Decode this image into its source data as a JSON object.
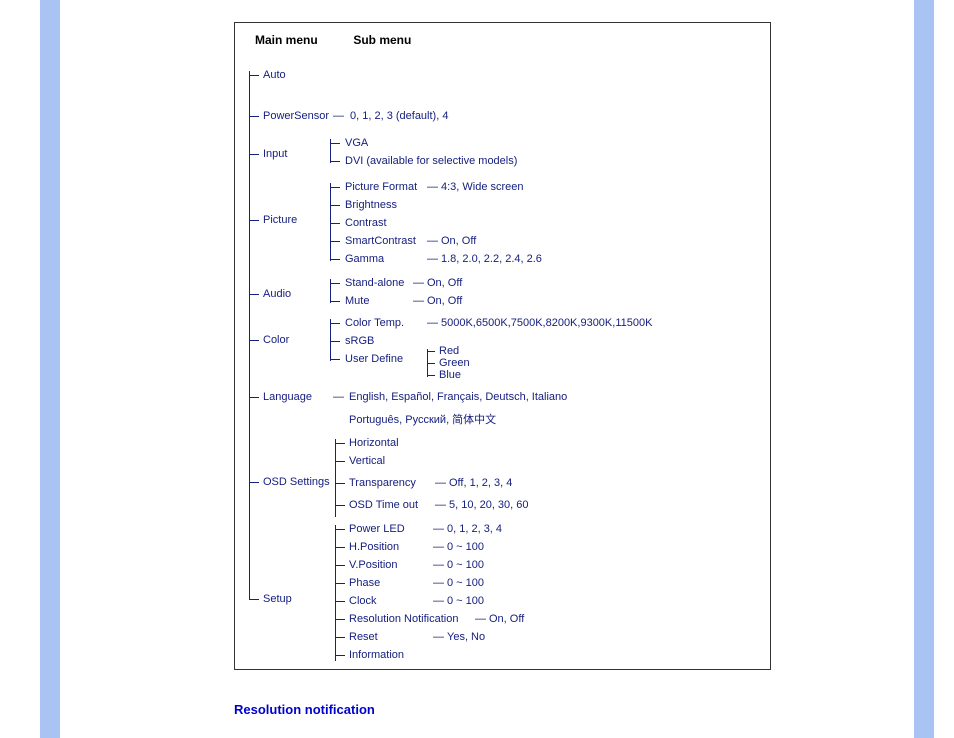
{
  "header": {
    "main": "Main menu",
    "sub": "Sub menu"
  },
  "main": {
    "auto": "Auto",
    "powersensor": "PowerSensor",
    "input": "Input",
    "picture": "Picture",
    "audio": "Audio",
    "color": "Color",
    "language": "Language",
    "osd": "OSD Settings",
    "setup": "Setup"
  },
  "powersensor": {
    "values": "0, 1, 2, 3 (default), 4"
  },
  "input": {
    "vga": "VGA",
    "dvi": "DVI (available for selective models)"
  },
  "picture": {
    "pf": "Picture Format",
    "pf_vals": "4:3, Wide screen",
    "brightness": "Brightness",
    "contrast": "Contrast",
    "sc": "SmartContrast",
    "sc_vals": "On, Off",
    "gamma": "Gamma",
    "gamma_vals": "1.8, 2.0, 2.2, 2.4, 2.6"
  },
  "audio": {
    "standalone": "Stand-alone",
    "standalone_vals": "On, Off",
    "mute": "Mute",
    "mute_vals": "On, Off"
  },
  "color": {
    "temp": "Color Temp.",
    "temp_vals": "5000K,6500K,7500K,8200K,9300K,11500K",
    "srgb": "sRGB",
    "user": "User Define",
    "red": "Red",
    "green": "Green",
    "blue": "Blue"
  },
  "language": {
    "line1": "English, Español, Français, Deutsch, Italiano",
    "line2": "Português, Русский, 简体中文"
  },
  "osd": {
    "horizontal": "Horizontal",
    "vertical": "Vertical",
    "transparency": "Transparency",
    "transparency_vals": "Off, 1, 2, 3, 4",
    "timeout": "OSD Time out",
    "timeout_vals": "5, 10, 20, 30, 60"
  },
  "setup": {
    "led": "Power LED",
    "led_vals": "0, 1, 2, 3, 4",
    "hpos": "H.Position",
    "hpos_vals": "0 ~ 100",
    "vpos": "V.Position",
    "vpos_vals": "0 ~ 100",
    "phase": "Phase",
    "phase_vals": "0 ~ 100",
    "clock": "Clock",
    "clock_vals": "0 ~ 100",
    "resolution": "Resolution Notification",
    "resolution_vals": "On, Off",
    "reset": "Reset",
    "reset_vals": "Yes, No",
    "info": "Information"
  },
  "section_title": "Resolution notification"
}
